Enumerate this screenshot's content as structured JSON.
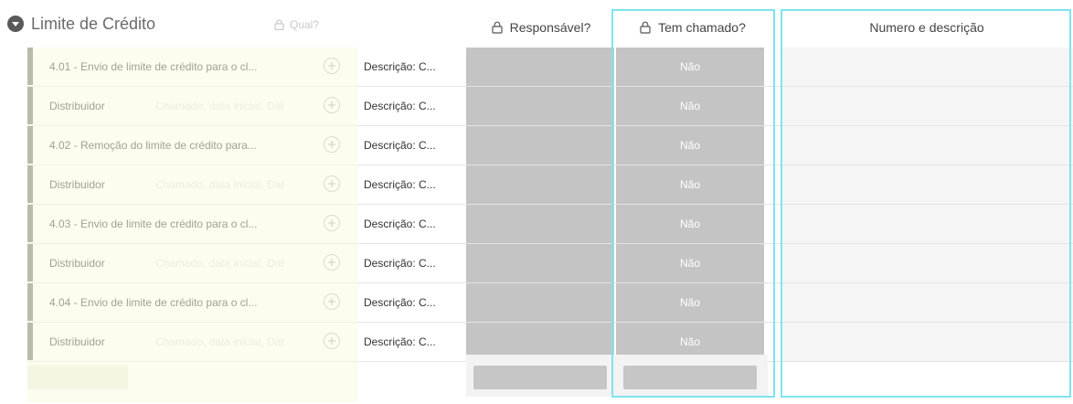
{
  "group": {
    "title": "Limite de Crédito",
    "faded_column_label": "Qual?"
  },
  "columns": {
    "responsavel": "Responsável?",
    "tem_chamado": "Tem chamado?",
    "numero_descricao": "Numero e descrição"
  },
  "rows": [
    {
      "name": "4.01 - Envio de limite de crédito para o cl...",
      "ghost": "",
      "desc": "Descrição: C...",
      "chamado": "Não"
    },
    {
      "name": "Distribuidor",
      "ghost": "Chamado, data inicial, Dat",
      "desc": "Descrição: C...",
      "chamado": "Não"
    },
    {
      "name": "4.02 - Remoção do limite de crédito para...",
      "ghost": "",
      "desc": "Descrição: C...",
      "chamado": "Não"
    },
    {
      "name": "Distribuidor",
      "ghost": "Chamado, data inicial, Dat",
      "desc": "Descrição: C...",
      "chamado": "Não"
    },
    {
      "name": "4.03 - Envio de limite de crédito para o cl...",
      "ghost": "",
      "desc": "Descrição: C...",
      "chamado": "Não"
    },
    {
      "name": "Distribuidor",
      "ghost": "Chamado, data inicial, Dat",
      "desc": "Descrição: C...",
      "chamado": "Não"
    },
    {
      "name": "4.04 - Envio de limite de crédito para o cl...",
      "ghost": "",
      "desc": "Descrição: C...",
      "chamado": "Não"
    },
    {
      "name": "Distribuidor",
      "ghost": "Chamado, data inicial, Dat",
      "desc": "Descrição: C...",
      "chamado": "Não"
    }
  ],
  "colors": {
    "highlight": "#7fe4ee",
    "cell_gray": "#c4c4c4",
    "row_bar": "#6e6e6e"
  }
}
